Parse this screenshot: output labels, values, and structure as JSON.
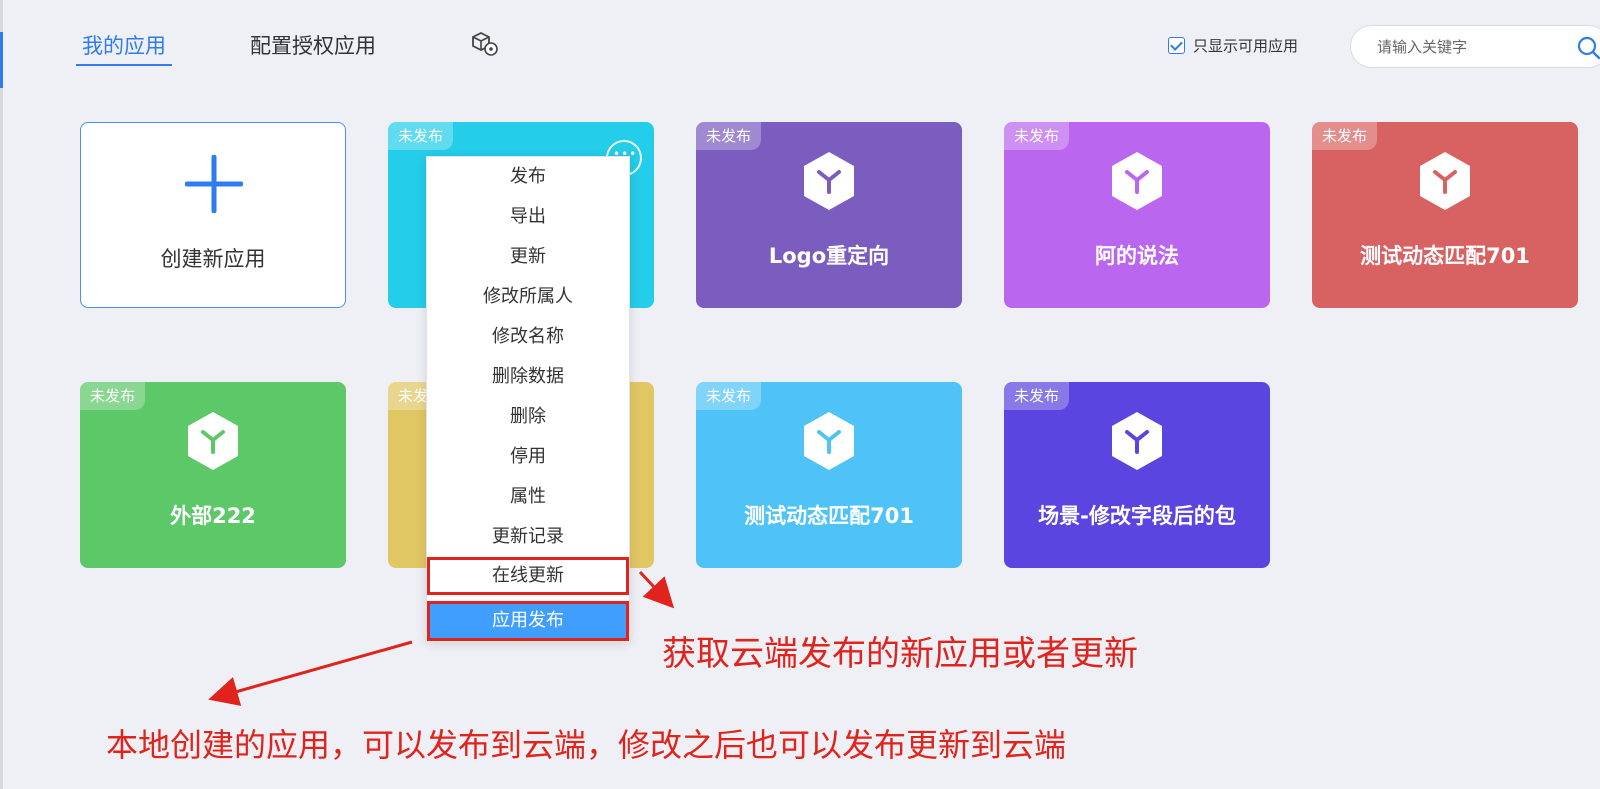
{
  "header": {
    "tabs": [
      {
        "label": "我的应用",
        "active": true
      },
      {
        "label": "配置授权应用",
        "active": false
      }
    ],
    "filter_label": "只显示可用应用",
    "filter_checked": true,
    "search_placeholder": "请输入关键字"
  },
  "create_card": {
    "label": "创建新应用"
  },
  "badge_text": "未发布",
  "cards": [
    {
      "name": "",
      "color": "#24cde9"
    },
    {
      "name": "Logo重定向",
      "color": "#7b5cbf"
    },
    {
      "name": "阿的说法",
      "color": "#bb66ee"
    },
    {
      "name": "测试动态匹配701",
      "color": "#d86162"
    },
    {
      "name": "外部222",
      "color": "#5dc868"
    },
    {
      "name": "",
      "color": "#e1c763"
    },
    {
      "name": "测试动态匹配701",
      "color": "#4fc3f7"
    },
    {
      "name": "场景-修改字段后的包",
      "color": "#5b45e0"
    }
  ],
  "menu": {
    "items": [
      "发布",
      "导出",
      "更新",
      "修改所属人",
      "修改名称",
      "删除数据",
      "删除",
      "停用",
      "属性",
      "更新记录",
      "在线更新",
      "应用发布"
    ]
  },
  "annotations": {
    "online_update": "获取云端发布的新应用或者更新",
    "app_publish": "本地创建的应用，可以发布到云端，修改之后也可以发布更新到云端"
  },
  "colors": {
    "accent": "#2f7bf0",
    "annotation": "#e0231c",
    "primary_button": "#409eff"
  }
}
